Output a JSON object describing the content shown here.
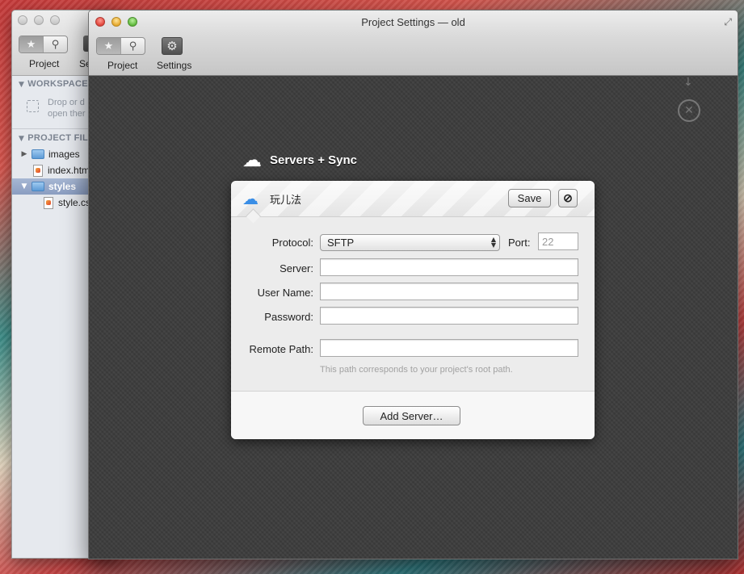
{
  "back_window": {
    "toolbar": {
      "project_label": "Project",
      "settings_label": "Se"
    },
    "workspace": {
      "heading": "WORKSPACE",
      "drop_line1": "Drop or d",
      "drop_line2": "open ther"
    },
    "project_files": {
      "heading": "PROJECT FILE",
      "items": [
        {
          "label": "images",
          "type": "folder",
          "expanded": false,
          "selected": false
        },
        {
          "label": "index.htm",
          "type": "file",
          "selected": false
        },
        {
          "label": "styles",
          "type": "folder",
          "expanded": true,
          "selected": true
        },
        {
          "label": "style.cs",
          "type": "file",
          "selected": false
        }
      ]
    }
  },
  "main_window": {
    "title": "Project Settings — old",
    "toolbar": {
      "project_label": "Project",
      "settings_label": "Settings"
    },
    "section": {
      "title": "Servers + Sync"
    },
    "server_card": {
      "server_name": "玩儿法",
      "save_label": "Save",
      "form": {
        "protocol_label": "Protocol:",
        "protocol_value": "SFTP",
        "port_label": "Port:",
        "port_placeholder": "22",
        "server_label": "Server:",
        "server_value": "",
        "username_label": "User Name:",
        "username_value": "",
        "password_label": "Password:",
        "password_value": "",
        "remote_path_label": "Remote Path:",
        "remote_path_value": "",
        "remote_path_hint": "This path corresponds to your project's root path."
      },
      "add_server_label": "Add Server…"
    }
  },
  "icons": {
    "star": "star-icon",
    "search": "search-icon",
    "settings": "gear-icon",
    "cloud": "cloud-icon",
    "cancel": "no-entry-icon",
    "close": "close-circle-icon",
    "download": "arrow-down-icon",
    "fullscreen": "fullscreen-icon"
  },
  "colors": {
    "content_bg": "#3d3d3d",
    "selection": "#8a9dc1",
    "cloud_accent": "#3a8ee6"
  }
}
